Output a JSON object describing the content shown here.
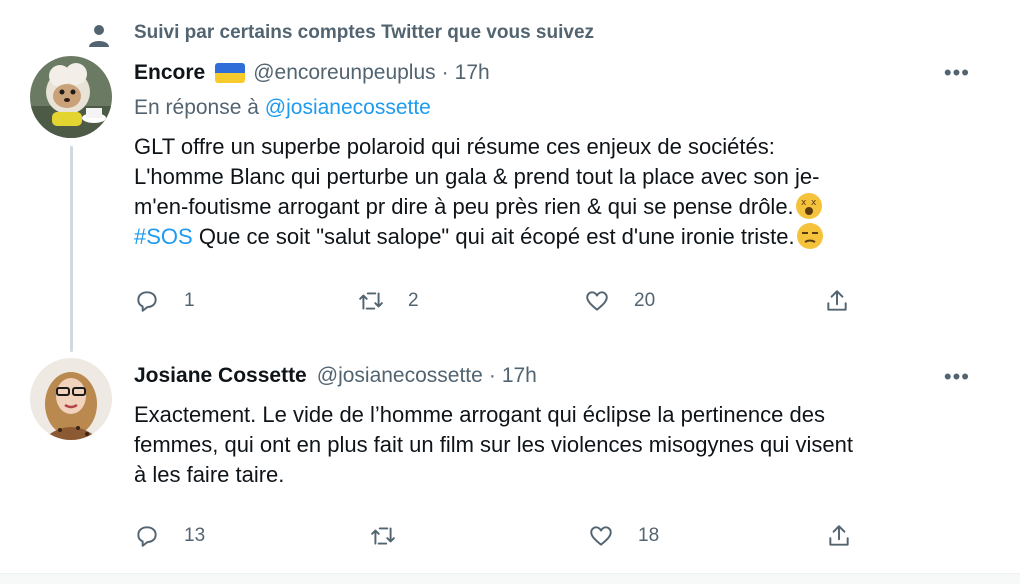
{
  "social_context": {
    "text": "Suivi par certains comptes Twitter que vous suivez",
    "icon": "person-icon"
  },
  "tweets": [
    {
      "name": "Encore",
      "flag": "ukraine-flag",
      "handle": "@encoreunpeuplus",
      "separator": "·",
      "time": "17h",
      "reply_prefix": "En réponse à",
      "reply_mention": "@josianecossette",
      "lines": [
        "GLT offre un superbe polaroid qui résume ces enjeux de sociétés:",
        "L'homme Blanc qui perturbe un gala & prend tout la place avec son je-",
        "m'en-foutisme arrogant pr dire à peu près rien & qui se pense drôle."
      ],
      "hashtag": "#SOS",
      "line4_rest": " Que ce soit \"salut salope\" qui ait écopé est d'une ironie triste.",
      "emoji1": "dizzy-face-emoji",
      "emoji2": "unamused-face-emoji",
      "reply_count": "1",
      "retweet_count": "2",
      "like_count": "20"
    },
    {
      "name": "Josiane Cossette",
      "handle": "@josianecossette",
      "separator": "·",
      "time": "17h",
      "lines": [
        "Exactement. Le vide de l’homme arrogant qui éclipse la pertinence des",
        "femmes, qui ont en plus fait un film sur les violences misogynes qui visent",
        "à les faire taire."
      ],
      "reply_count": "13",
      "retweet_count": "",
      "like_count": "18"
    }
  ],
  "more_label": "•••",
  "colors": {
    "accent": "#1d9bf0",
    "secondary": "#536471",
    "text": "#0f1419"
  }
}
